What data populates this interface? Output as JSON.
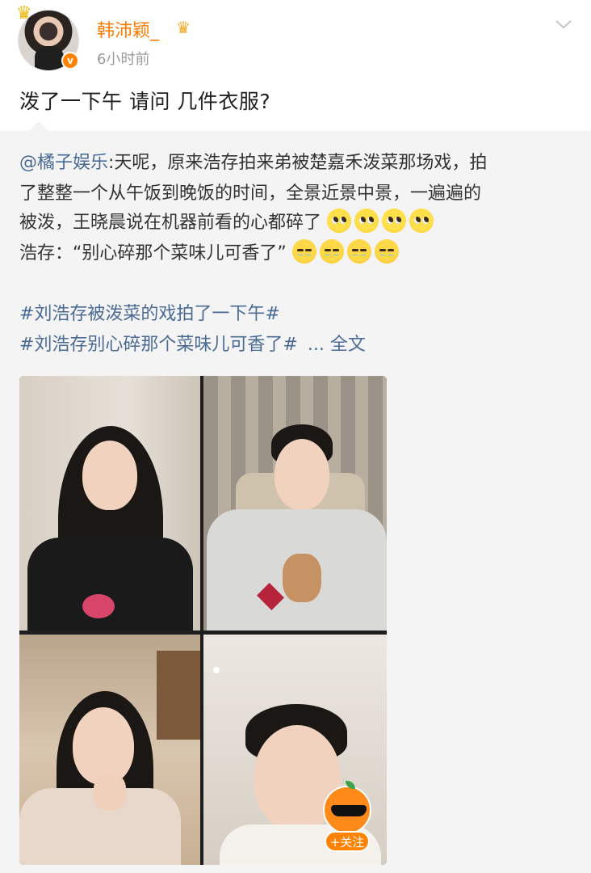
{
  "author": {
    "name": "韩沛颖_",
    "time": "6小时前",
    "verified_badge": "v",
    "accent_color": "#ff7a00"
  },
  "post": {
    "text": "泼了一下午 请问 几件衣服?"
  },
  "repost": {
    "mention": "@橘子娱乐",
    "line1_rest": ":天呢，原来浩存拍来弟被楚嘉禾泼菜那场戏，拍",
    "line2": "了整整一个从午饭到晚饭的时间，全景近景中景，一遍遍的",
    "line3": "被泼，王晓晨说在机器前看的心都碎了",
    "line4": "浩存：“别心碎那个菜味儿可香了”",
    "hashtag1": "#刘浩存被泼菜的戏拍了一下午#",
    "hashtag2": "#刘浩存别心碎那个菜味儿可香了#",
    "more": "... 全文",
    "link_color": "#4a6a94"
  },
  "follow_button": {
    "label": "+关注"
  },
  "icons": {
    "chevron": "chevron-down-icon",
    "crown": "crown-icon"
  }
}
